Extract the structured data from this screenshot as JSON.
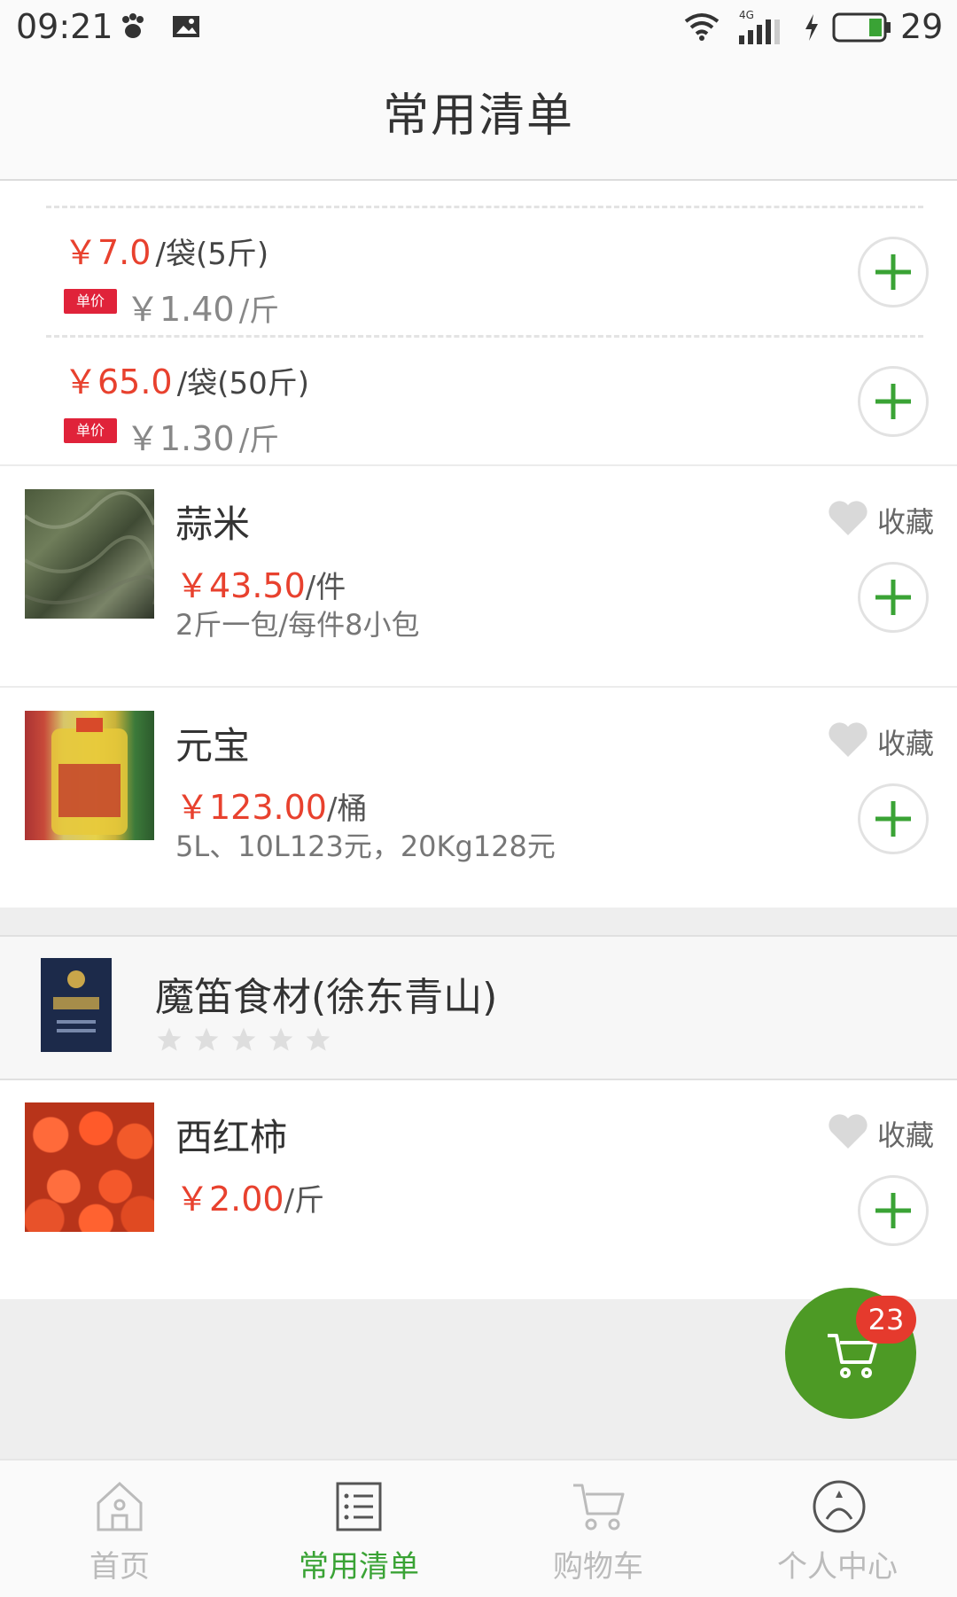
{
  "status_bar": {
    "time": "09:21",
    "network": "4G",
    "battery": "29"
  },
  "header": {
    "title": "常用清单"
  },
  "price_options": [
    {
      "price": "￥7.0",
      "unit": "/袋(5斤)",
      "unit_tag": "单价",
      "unit_price": "￥1.40",
      "unit_suffix": "/斤"
    },
    {
      "price": "￥65.0",
      "unit": "/袋(50斤)",
      "unit_tag": "单价",
      "unit_price": "￥1.30",
      "unit_suffix": "/斤"
    }
  ],
  "products": [
    {
      "name": "蒜米",
      "price": "￥43.50",
      "unit": "/件",
      "desc": "2斤一包/每件8小包",
      "fav_label": "收藏"
    },
    {
      "name": "元宝",
      "price": "￥123.00",
      "unit": "/桶",
      "desc": "5L、10L123元，20Kg128元",
      "fav_label": "收藏"
    },
    {
      "name": "西红柿",
      "price": "￥2.00",
      "unit": "/斤",
      "desc": "",
      "fav_label": "收藏"
    }
  ],
  "store": {
    "name": "魔笛食材(徐东青山)",
    "rating": 0,
    "rating_max": 5
  },
  "cart": {
    "count": "23"
  },
  "nav": {
    "items": [
      {
        "label": "首页",
        "icon": "home-icon",
        "active": false
      },
      {
        "label": "常用清单",
        "icon": "list-icon",
        "active": true
      },
      {
        "label": "购物车",
        "icon": "cart-icon",
        "active": false
      },
      {
        "label": "个人中心",
        "icon": "profile-icon",
        "active": false
      }
    ]
  },
  "colors": {
    "accent": "#3aa335",
    "price": "#e8412e",
    "fab": "#4d9a25",
    "badge": "#e53a2d"
  }
}
